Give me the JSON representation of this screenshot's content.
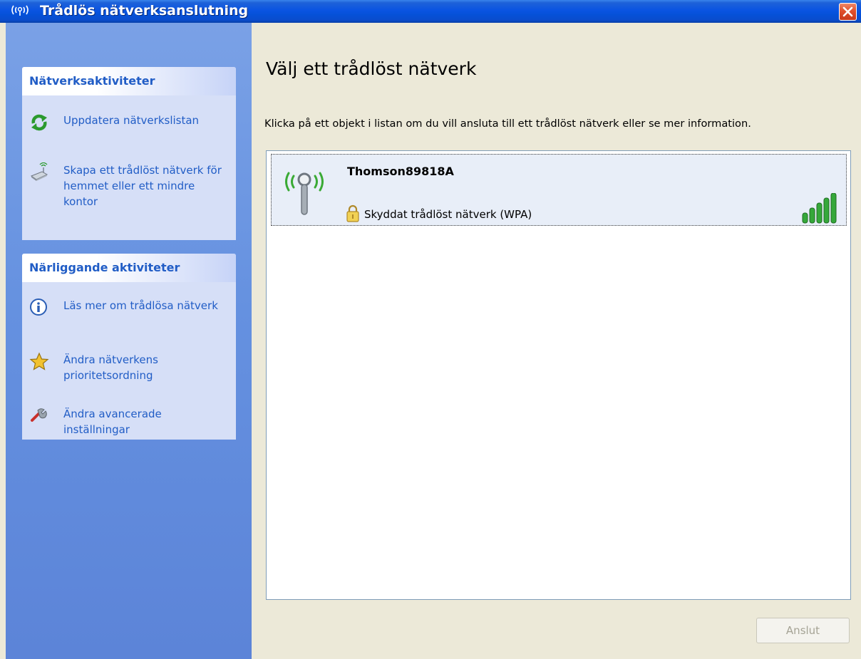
{
  "window": {
    "title": "Trådlös nätverksanslutning",
    "title_icon": "wireless-signal-icon",
    "close_icon": "close-icon"
  },
  "colors": {
    "titlebar": "#0a54e2",
    "sidebar": "#6591e0",
    "panel_background": "#d6dff7",
    "link_text": "#215dc6",
    "close_button": "#e0502c",
    "signal_green": "#35a83a"
  },
  "sidebar": {
    "network_tasks": {
      "title": "Nätverksaktiviteter",
      "items": [
        {
          "label": "Uppdatera nätverkslistan",
          "icon": "refresh-icon"
        },
        {
          "label": "Skapa ett trådlöst nätverk för hemmet eller ett mindre kontor",
          "icon": "wireless-setup-icon"
        }
      ]
    },
    "related_tasks": {
      "title": "Närliggande aktiviteter",
      "items": [
        {
          "label": "Läs mer om trådlösa nätverk",
          "icon": "info-icon"
        },
        {
          "label": "Ändra nätverkens prioritetsordning",
          "icon": "star-icon"
        },
        {
          "label": "Ändra avancerade inställningar",
          "icon": "tools-icon"
        }
      ]
    }
  },
  "main": {
    "heading": "Välj ett trådlöst nätverk",
    "instruction": "Klicka på ett objekt i listan om du vill ansluta till ett trådlöst nätverk eller se mer information.",
    "networks": [
      {
        "name": "Thomson89818A",
        "security": "Skyddat trådlöst nätverk (WPA)",
        "icon": "antenna-icon",
        "security_icon": "lock-icon",
        "signal_icon": "signal-strength-icon",
        "signal_bars": 5,
        "signal_max": 5
      }
    ],
    "connect_button": "Anslut"
  }
}
